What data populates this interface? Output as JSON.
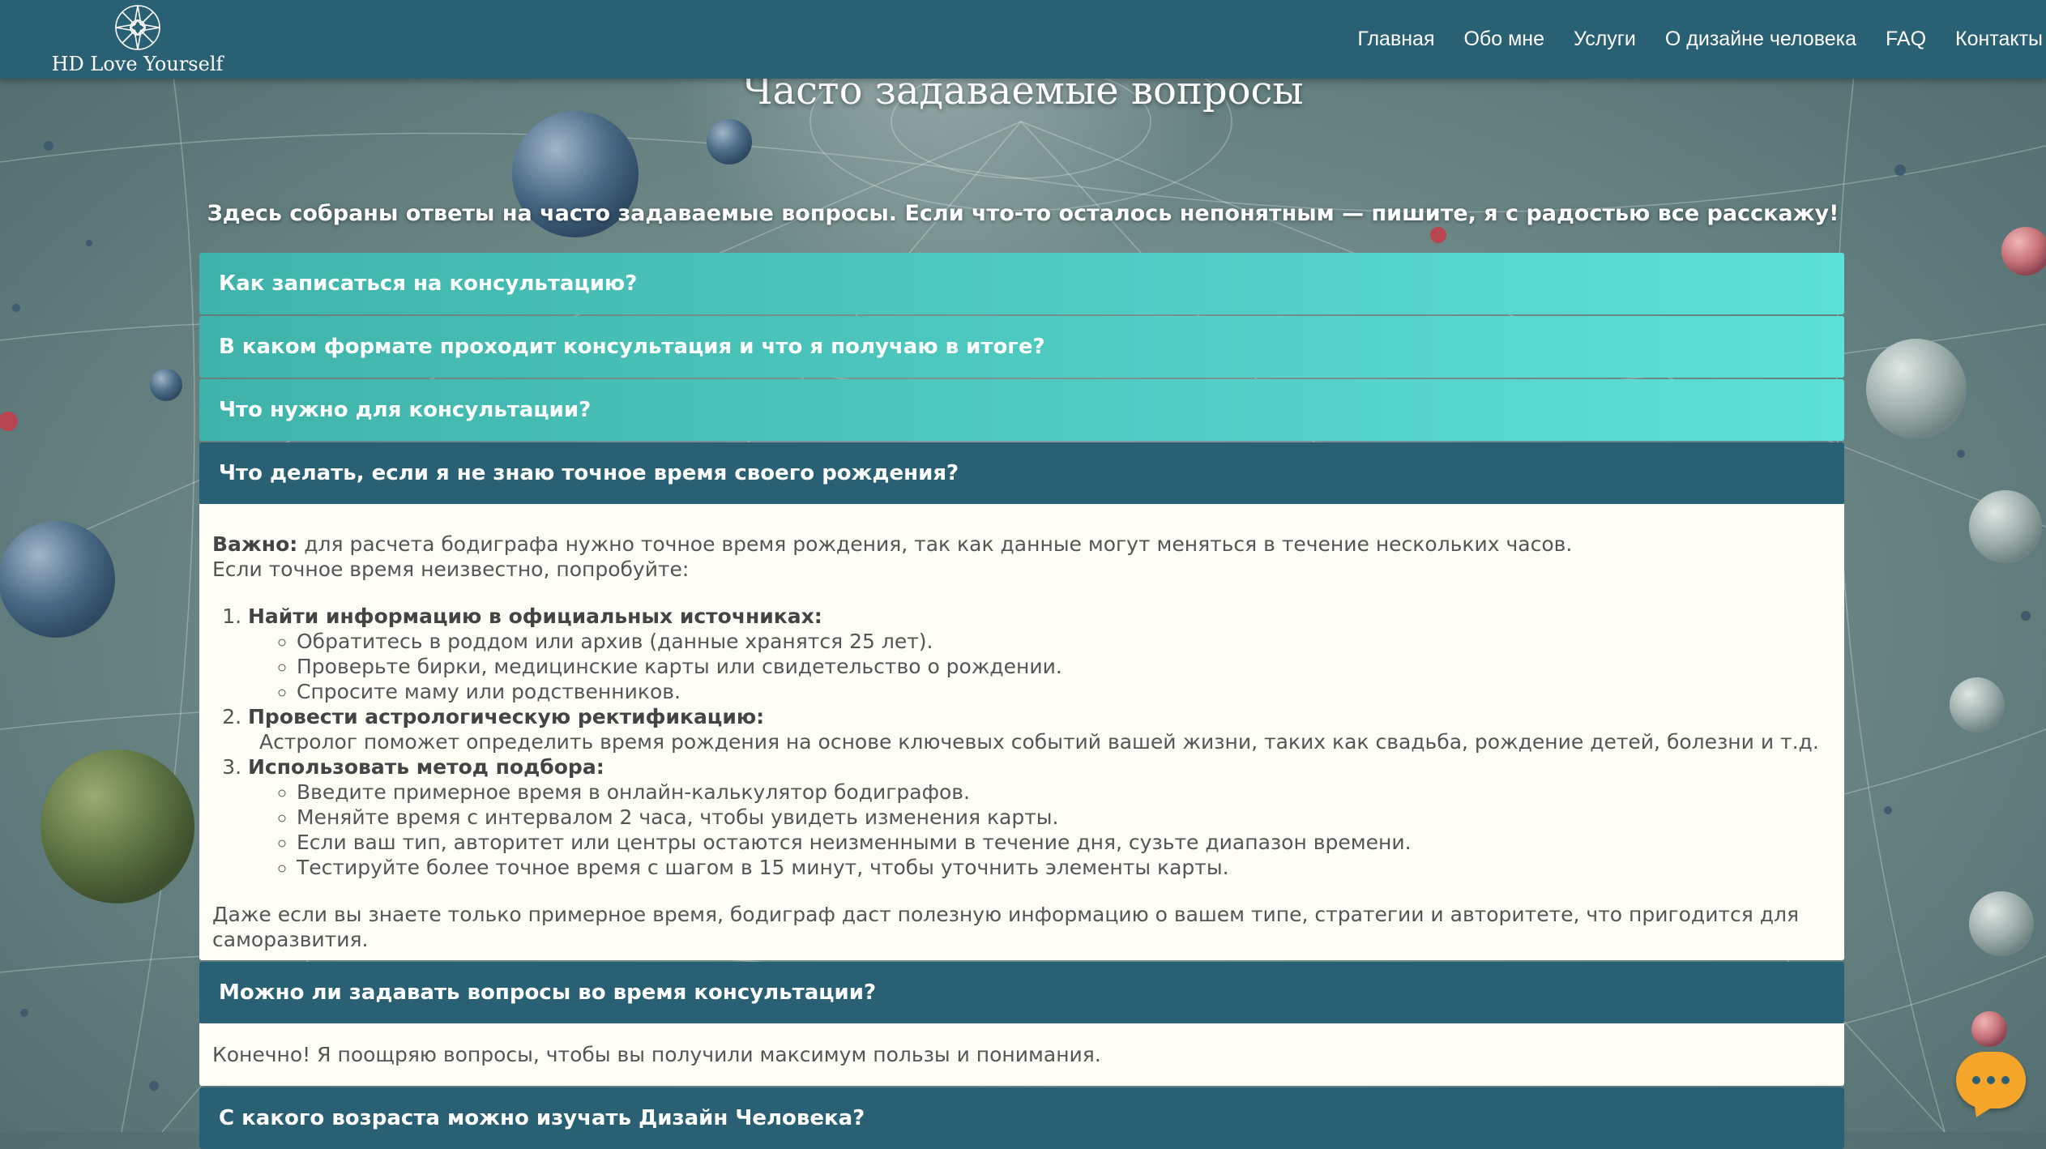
{
  "header": {
    "logo_text": "HD Love Yourself",
    "nav": [
      "Главная",
      "Обо мне",
      "Услуги",
      "О дизайне человека",
      "FAQ",
      "Контакты"
    ]
  },
  "page": {
    "title": "Часто задаваемые вопросы",
    "intro": "Здесь собраны ответы на часто задаваемые вопросы. Если что-то осталось непонятным — пишите, я с радостью все расскажу!"
  },
  "faq": {
    "q1": "Как записаться на консультацию?",
    "q2": "В каком формате проходит консультация и что я получаю в итоге?",
    "q3": "Что нужно для консультации?",
    "q4": "Что делать, если я не знаю точное время своего рождения?",
    "a4": {
      "important_label": "Важно:",
      "important_text": " для расчета бодиграфа нужно точное время рождения, так как данные могут меняться в течение нескольких часов.",
      "unknown_text": "Если точное время неизвестно, попробуйте:",
      "step1_title": "Найти информацию в официальных источниках:",
      "step1_items": [
        "Обратитесь в роддом или архив (данные хранятся 25 лет).",
        "Проверьте бирки, медицинские карты или свидетельство о рождении.",
        "Спросите маму или родственников."
      ],
      "step2_title": "Провести астрологическую ректификацию:",
      "step2_text": "Астролог поможет определить время рождения на основе ключевых событий вашей жизни, таких как свадьба, рождение детей, болезни и т.д.",
      "step3_title": "Использовать метод подбора:",
      "step3_items": [
        "Введите примерное время в онлайн-калькулятор бодиграфов.",
        "Меняйте время с интервалом 2 часа, чтобы увидеть изменения карты.",
        "Если ваш тип, авторитет или центры остаются неизменными в течение дня, сузьте диапазон времени.",
        "Тестируйте более точное время с шагом в 15 минут, чтобы уточнить элементы карты."
      ],
      "conclusion": "Даже если вы знаете только примерное время, бодиграф даст полезную информацию о вашем типе, стратегии и авторитете, что пригодится для саморазвития."
    },
    "q5": "Можно ли задавать вопросы во время консультации?",
    "a5": "Конечно! Я поощряю вопросы, чтобы вы получили максимум пользы и понимания.",
    "q6": "С какого возраста можно изучать Дизайн Человека?"
  },
  "icons": {
    "logo": "mandala-icon",
    "chat": "chat-bubble-icon"
  },
  "colors": {
    "header": "#2a6073",
    "accordion_closed_start": "#3fb3a9",
    "accordion_closed_end": "#5de0d8",
    "accordion_open": "#2a6073",
    "answer_bg": "#fefef6",
    "chat_button": "#f5a52a"
  }
}
